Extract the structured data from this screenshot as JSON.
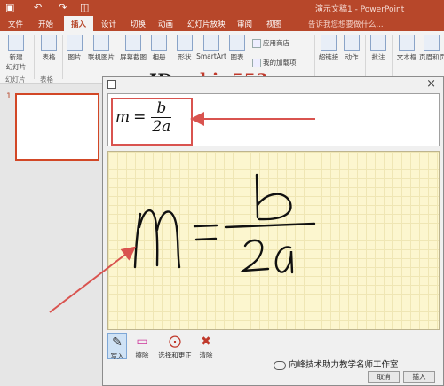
{
  "title_bar": {
    "document_title": "演示文稿1 - PowerPoint",
    "quick_access": [
      "save-icon",
      "undo-icon",
      "redo-icon",
      "start-from-beginning-icon"
    ]
  },
  "ribbon_tabs": {
    "items": [
      "文件",
      "开始",
      "插入",
      "设计",
      "切换",
      "动画",
      "幻灯片放映",
      "审阅",
      "视图"
    ],
    "active": "插入",
    "tell_me": "告诉我您想要做什么..."
  },
  "ribbon": {
    "new_slide": "新建\n幻灯片",
    "table": "表格",
    "picture": "图片",
    "online_picture": "联机图片",
    "screenshot": "屏幕截图",
    "album": "相册",
    "shapes": "形状",
    "smartart": "SmartArt",
    "chart": "图表",
    "store": "应用商店",
    "my_addins": "我的加载项",
    "hyperlink": "超链接",
    "action": "动作",
    "comment": "批注",
    "textbox": "文本框",
    "header_footer": "页眉和页脚",
    "group_slides": "幻灯片",
    "group_tables": "表格"
  },
  "watermark": {
    "prefix": "ID ",
    "name": "robin553"
  },
  "slides_pane": {
    "slide_number": "1"
  },
  "ink_equation_dialog": {
    "close": "×",
    "preview_formula": {
      "lhs": "m",
      "eq": "=",
      "numerator": "b",
      "denominator": "2a"
    },
    "handwritten_text": "m = b/2a",
    "tools": [
      {
        "name": "write",
        "label": "写入",
        "icon": "pen-icon"
      },
      {
        "name": "erase",
        "label": "擦除",
        "icon": "eraser-icon"
      },
      {
        "name": "select-correct",
        "label": "选择和更正",
        "icon": "lasso-icon"
      },
      {
        "name": "clear",
        "label": "清除",
        "icon": "clear-icon"
      }
    ],
    "cancel_button": "取消",
    "insert_button": "插入"
  },
  "wechat_watermark": "向峰技术助力教学名师工作室",
  "colors": {
    "ppt_orange": "#b7472a",
    "annotation_red": "#d9534f",
    "pad_yellow": "#fcf6cf"
  }
}
